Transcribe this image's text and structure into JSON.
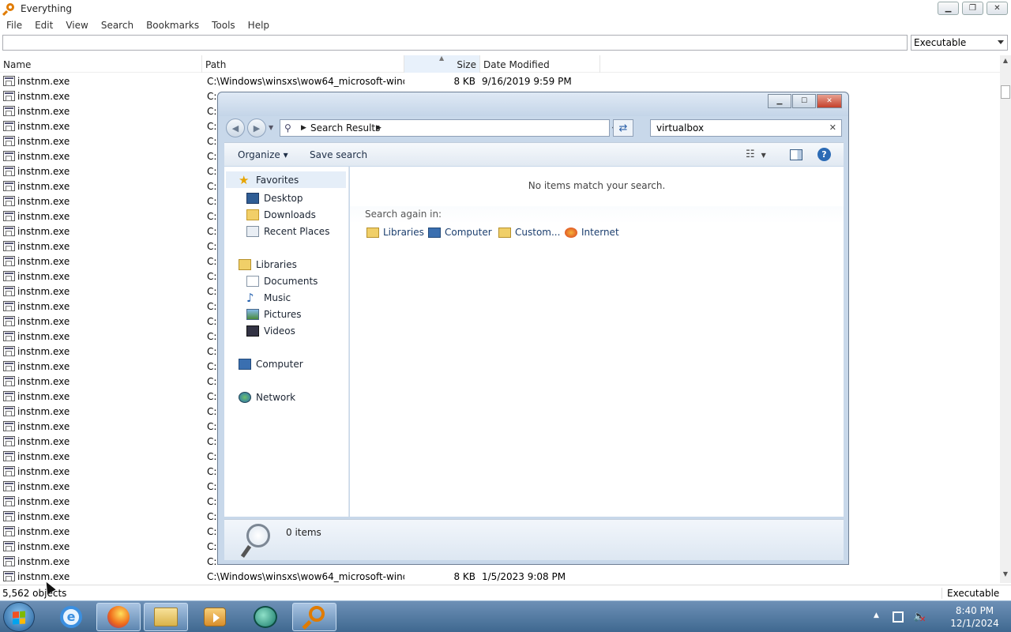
{
  "everything": {
    "title": "Everything",
    "menu": [
      "File",
      "Edit",
      "View",
      "Search",
      "Bookmarks",
      "Tools",
      "Help"
    ],
    "search_value": "",
    "filter": "Executable",
    "columns": {
      "name": "Name",
      "path": "Path",
      "size": "Size",
      "date": "Date Modified"
    },
    "rows": [
      {
        "name": "instnm.exe",
        "path": "C:\\Windows\\winsxs\\wow64_microsoft-wind...",
        "size": "8 KB",
        "date": "9/16/2019 9:59 PM"
      },
      {
        "name": "instnm.exe",
        "path": "C:",
        "size": "",
        "date": ""
      },
      {
        "name": "instnm.exe",
        "path": "C:",
        "size": "",
        "date": ""
      },
      {
        "name": "instnm.exe",
        "path": "C:",
        "size": "",
        "date": ""
      },
      {
        "name": "instnm.exe",
        "path": "C:",
        "size": "",
        "date": ""
      },
      {
        "name": "instnm.exe",
        "path": "C:",
        "size": "",
        "date": ""
      },
      {
        "name": "instnm.exe",
        "path": "C:",
        "size": "",
        "date": ""
      },
      {
        "name": "instnm.exe",
        "path": "C:",
        "size": "",
        "date": ""
      },
      {
        "name": "instnm.exe",
        "path": "C:",
        "size": "",
        "date": ""
      },
      {
        "name": "instnm.exe",
        "path": "C:",
        "size": "",
        "date": ""
      },
      {
        "name": "instnm.exe",
        "path": "C:",
        "size": "",
        "date": ""
      },
      {
        "name": "instnm.exe",
        "path": "C:",
        "size": "",
        "date": ""
      },
      {
        "name": "instnm.exe",
        "path": "C:",
        "size": "",
        "date": ""
      },
      {
        "name": "instnm.exe",
        "path": "C:",
        "size": "",
        "date": ""
      },
      {
        "name": "instnm.exe",
        "path": "C:",
        "size": "",
        "date": ""
      },
      {
        "name": "instnm.exe",
        "path": "C:",
        "size": "",
        "date": ""
      },
      {
        "name": "instnm.exe",
        "path": "C:",
        "size": "",
        "date": ""
      },
      {
        "name": "instnm.exe",
        "path": "C:",
        "size": "",
        "date": ""
      },
      {
        "name": "instnm.exe",
        "path": "C:",
        "size": "",
        "date": ""
      },
      {
        "name": "instnm.exe",
        "path": "C:",
        "size": "",
        "date": ""
      },
      {
        "name": "instnm.exe",
        "path": "C:",
        "size": "",
        "date": ""
      },
      {
        "name": "instnm.exe",
        "path": "C:",
        "size": "",
        "date": ""
      },
      {
        "name": "instnm.exe",
        "path": "C:",
        "size": "",
        "date": ""
      },
      {
        "name": "instnm.exe",
        "path": "C:",
        "size": "",
        "date": ""
      },
      {
        "name": "instnm.exe",
        "path": "C:",
        "size": "",
        "date": ""
      },
      {
        "name": "instnm.exe",
        "path": "C:",
        "size": "",
        "date": ""
      },
      {
        "name": "instnm.exe",
        "path": "C:",
        "size": "",
        "date": ""
      },
      {
        "name": "instnm.exe",
        "path": "C:",
        "size": "",
        "date": ""
      },
      {
        "name": "instnm.exe",
        "path": "C:",
        "size": "",
        "date": ""
      },
      {
        "name": "instnm.exe",
        "path": "C:",
        "size": "",
        "date": ""
      },
      {
        "name": "instnm.exe",
        "path": "C:",
        "size": "",
        "date": ""
      },
      {
        "name": "instnm.exe",
        "path": "C:",
        "size": "",
        "date": ""
      },
      {
        "name": "instnm.exe",
        "path": "C:",
        "size": "",
        "date": ""
      },
      {
        "name": "instnm.exe",
        "path": "C:\\Windows\\winsxs\\wow64_microsoft-wind...",
        "size": "8 KB",
        "date": "1/5/2023 9:08 PM"
      }
    ],
    "status_count": "5,562 objects",
    "status_filter": "Executable"
  },
  "explorer": {
    "breadcrumb": "Search Results",
    "search_value": "virtualbox",
    "toolbar": {
      "organize": "Organize",
      "save_search": "Save search"
    },
    "nav": {
      "favorites": "Favorites",
      "desktop": "Desktop",
      "downloads": "Downloads",
      "recent": "Recent Places",
      "libraries": "Libraries",
      "documents": "Documents",
      "music": "Music",
      "pictures": "Pictures",
      "videos": "Videos",
      "computer": "Computer",
      "network": "Network"
    },
    "no_items": "No items match your search.",
    "search_again": "Search again in:",
    "locations": {
      "libraries": "Libraries",
      "computer": "Computer",
      "custom": "Custom...",
      "internet": "Internet"
    },
    "item_count": "0 items"
  },
  "taskbar": {
    "apps": [
      "internet-explorer-icon",
      "firefox-icon",
      "file-explorer-icon",
      "media-player-icon",
      "virtualbox-icon",
      "everything-icon"
    ],
    "time": "8:40 PM",
    "date": "12/1/2024"
  }
}
